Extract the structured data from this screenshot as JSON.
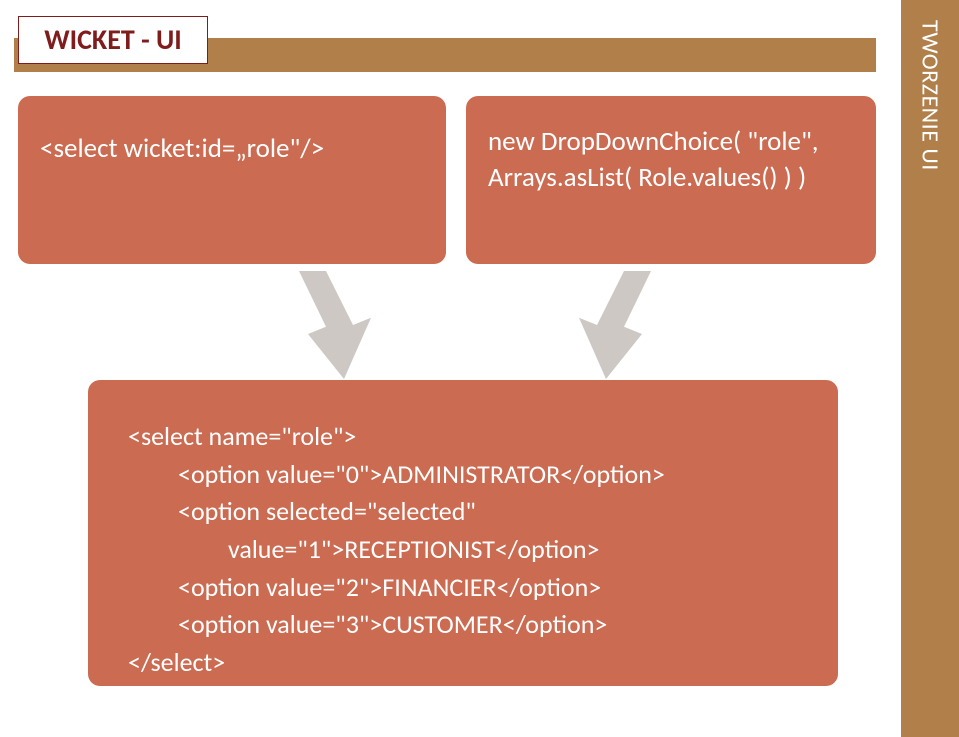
{
  "title": "WICKET - UI",
  "sidebar_text": "TWORZENIE UI",
  "left_card": "<select wicket:id=„role\"/>",
  "right_card_line1": "new DropDownChoice( \"role\",",
  "right_card_line2": "Arrays.asList( Role.values() ) )",
  "bottom": {
    "l1": "<select name=\"role\">",
    "l2": "<option value=\"0\">ADMINISTRATOR</option>",
    "l3": "<option selected=\"selected\"",
    "l4": "value=\"1\">RECEPTIONIST</option>",
    "l5": "<option value=\"2\">FINANCIER</option>",
    "l6": "<option value=\"3\">CUSTOMER</option>",
    "l7": "</select>"
  }
}
